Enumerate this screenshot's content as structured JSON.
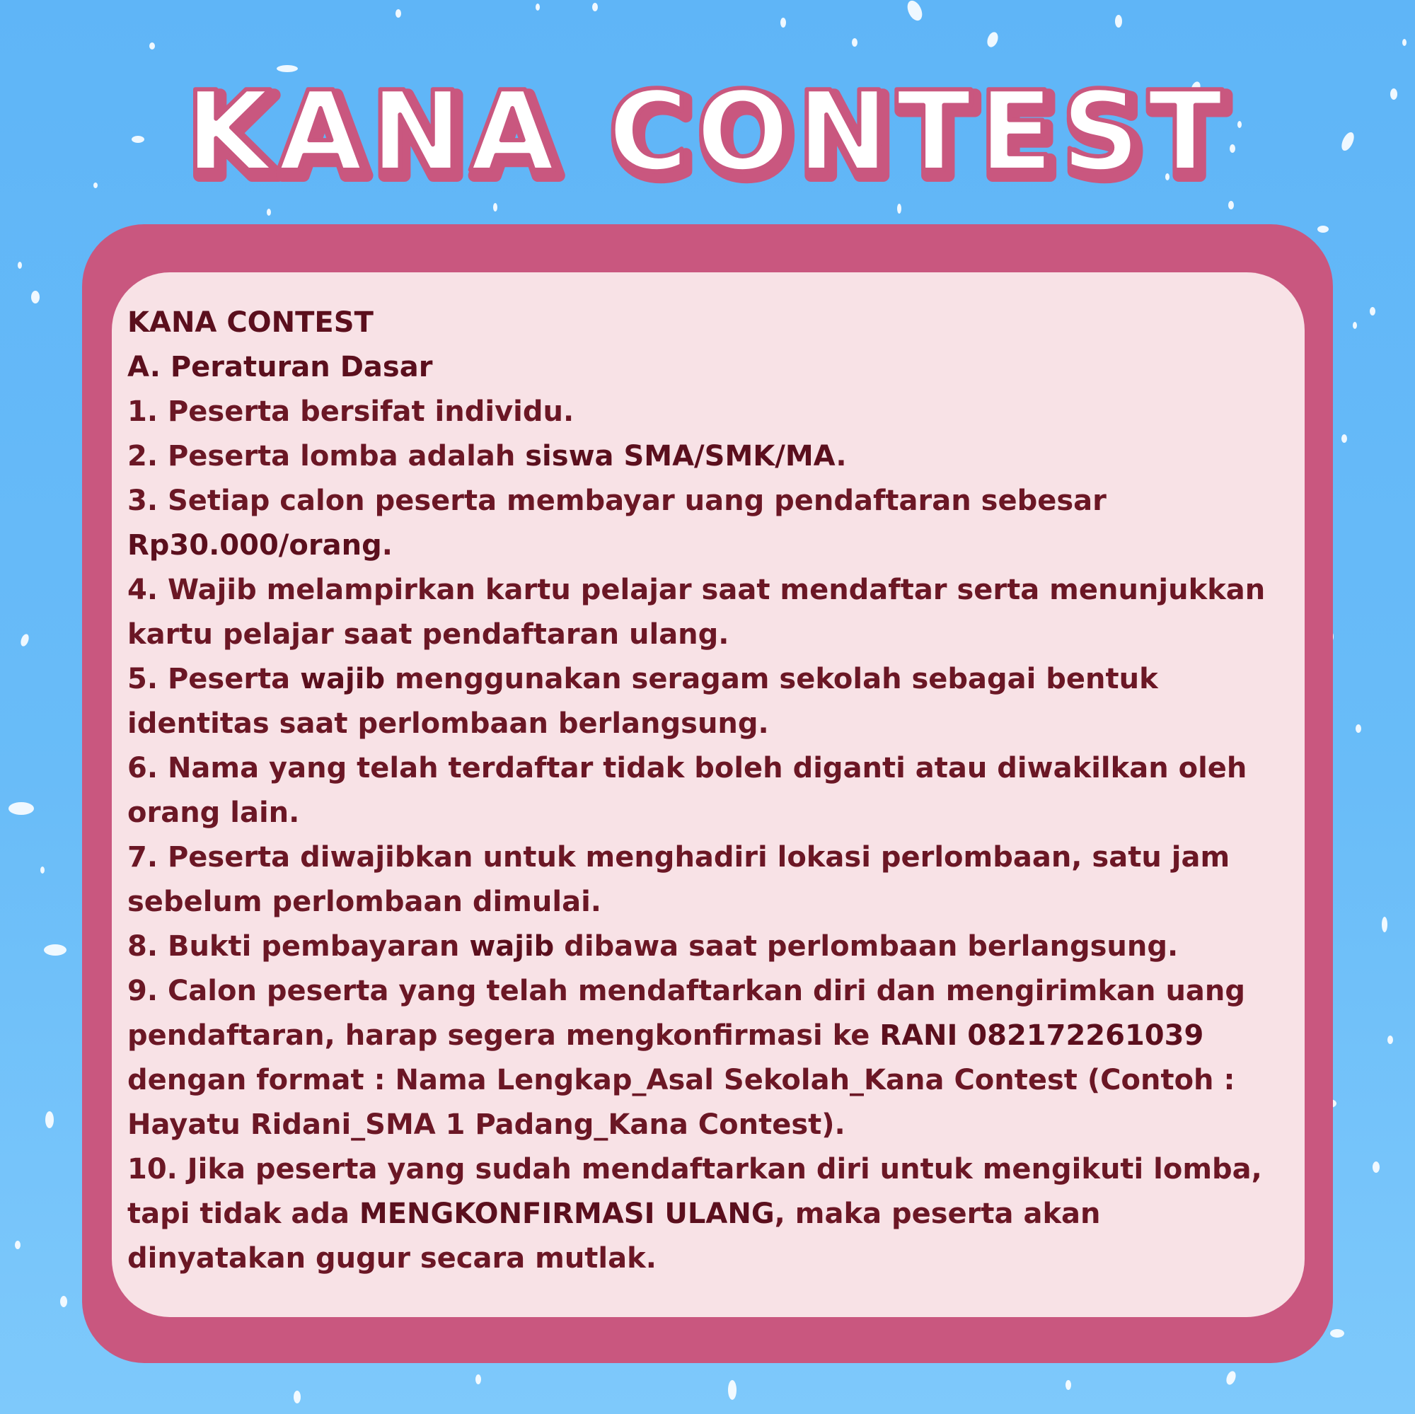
{
  "banner_title": "KANA CONTEST",
  "colors": {
    "background": "#66baf8",
    "card_border": "#c9577f",
    "card_fill": "#f8e2e6",
    "text": "#6b1725",
    "title_outline": "#c9577f",
    "title_fill": "#ffffff"
  },
  "content": {
    "heading": "KANA CONTEST",
    "section": "A. Peraturan Dasar",
    "rules": [
      {
        "line1": "1. Peserta bersifat individu."
      },
      {
        "pre": "2. Peserta lomba adalah ",
        "bold": "siswa SMA/SMK/MA",
        "post": "."
      },
      {
        "line1": "3. Setiap calon peserta membayar uang pendaftaran sebesar",
        "bold": "Rp30.000/orang",
        "post": "."
      },
      {
        "line1": "4. Wajib melampirkan kartu pelajar saat mendaftar serta menunjukkan",
        "line2": "kartu pelajar saat pendaftaran ulang."
      },
      {
        "pre": "5. Peserta ",
        "bold": "wajib",
        "post": " menggunakan seragam sekolah sebagai bentuk",
        "line2": "identitas saat perlombaan berlangsung."
      },
      {
        "line1": "6. Nama yang telah terdaftar tidak boleh diganti atau diwakilkan oleh",
        "line2": "orang lain."
      },
      {
        "line1": "7. Peserta diwajibkan untuk menghadiri lokasi perlombaan, satu jam",
        "line2": "sebelum perlombaan dimulai."
      },
      {
        "pre": "8. Bukti pembayaran ",
        "bold": "wajib",
        "post": " dibawa saat perlombaan berlangsung."
      },
      {
        "line1": "9. Calon peserta yang telah mendaftarkan diri dan mengirimkan uang",
        "pre2": "pendaftaran, harap segera mengkonfirmasi ke ",
        "bold": "RANI 082172261039",
        "line3": "dengan format : Nama Lengkap_Asal Sekolah_Kana Contest (Contoh :",
        "line4": "Hayatu Ridani_SMA 1 Padang_Kana Contest)."
      },
      {
        "line1": "10. Jika peserta yang sudah mendaftarkan diri untuk mengikuti lomba,",
        "pre2": "tapi tidak ada ",
        "bold": "MENGKONFIRMASI ULANG",
        "post2": ", maka peserta akan",
        "line3": "dinyatakan gugur secara mutlak."
      }
    ]
  }
}
